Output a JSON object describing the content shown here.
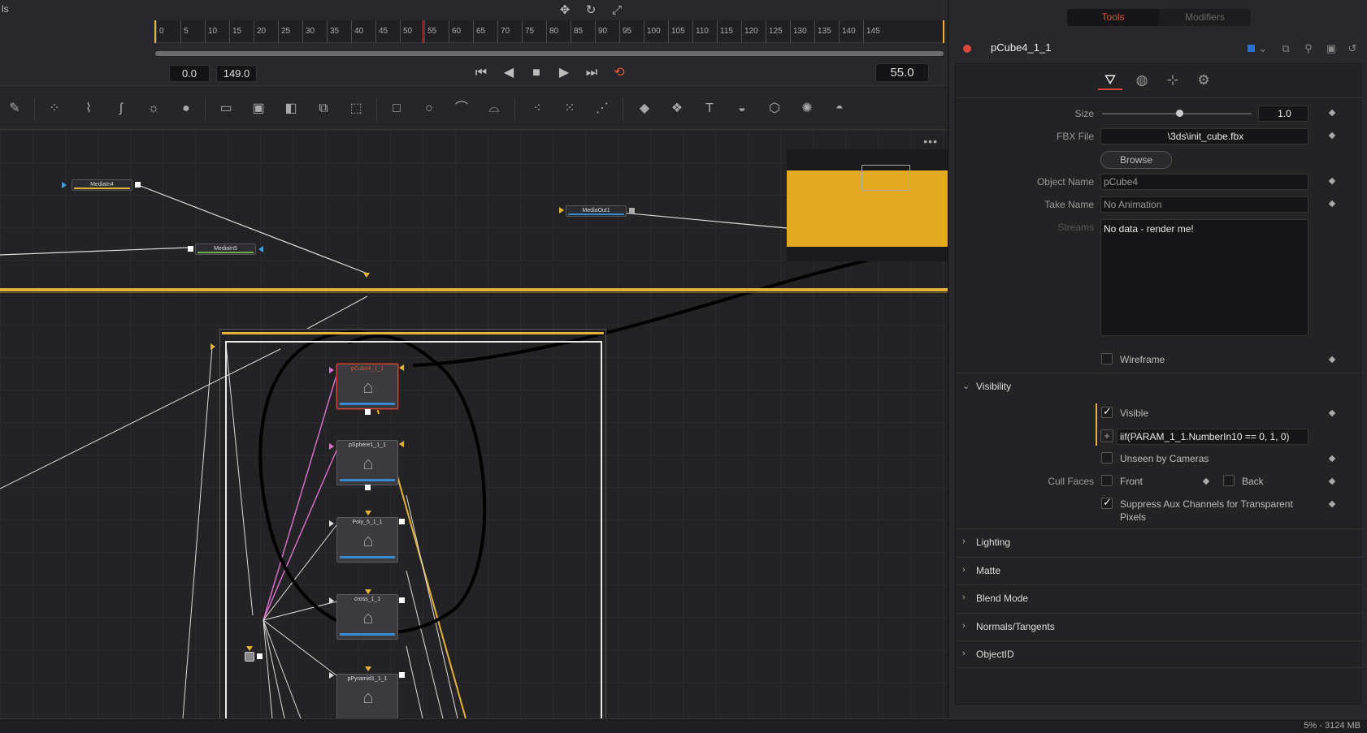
{
  "left_strip": {
    "text": "ls"
  },
  "timeline": {
    "ticks": [
      "0",
      "5",
      "10",
      "15",
      "20",
      "25",
      "30",
      "35",
      "40",
      "45",
      "50",
      "55",
      "60",
      "65",
      "70",
      "75",
      "80",
      "85",
      "90",
      "95",
      "100",
      "105",
      "110",
      "115",
      "120",
      "125",
      "130",
      "135",
      "140",
      "145"
    ],
    "start_frame": "0.0",
    "end_frame": "149.0",
    "current_frame": "55.0"
  },
  "flow": {
    "nodes": {
      "mediain4": "MediaIn4",
      "mediain5": "MediaIn5",
      "mediaout1": "MediaOut1",
      "pcube": "pCube4_1_1",
      "psphere": "pSphere1_1_1",
      "poly": "Poly_5_1_1",
      "cross": "cross_1_1",
      "ppyramid": "pPyramid1_1_1"
    }
  },
  "inspector": {
    "tabs": [
      "Tools",
      "Modifiers"
    ],
    "tool_name": "pCube4_1_1",
    "size_label": "Size",
    "size_value": "1.0",
    "fbx_label": "FBX File",
    "fbx_value": "\\3ds\\init_cube.fbx",
    "browse_label": "Browse",
    "object_name_label": "Object Name",
    "object_name_value": "pCube4",
    "take_name_label": "Take Name",
    "take_name_value": "No Animation",
    "streams_label": "Streams",
    "streams_value": "No data - render me!",
    "wireframe_label": "Wireframe",
    "visibility_title": "Visibility",
    "visible_label": "Visible",
    "expression_value": "iif(PARAM_1_1.NumberIn10 == 0, 1, 0)",
    "unseen_label": "Unseen by Cameras",
    "cull_faces_label": "Cull Faces",
    "front_label": "Front",
    "back_label": "Back",
    "suppress_label_1": "Suppress Aux Channels for Transparent",
    "suppress_label_2": "Pixels",
    "sections": [
      "Lighting",
      "Matte",
      "Blend Mode",
      "Normals/Tangents",
      "ObjectID"
    ]
  },
  "status": {
    "memory": "5% - 3124 MB"
  },
  "colors": {
    "accent": "#e6b33a",
    "selection": "#d8473a",
    "blue": "#3a8ad0"
  }
}
